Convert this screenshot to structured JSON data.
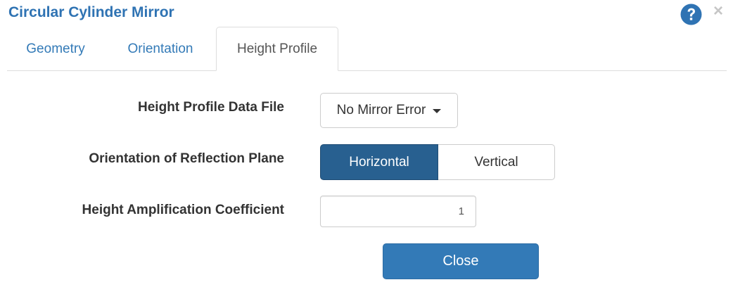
{
  "dialog": {
    "title": "Circular Cylinder Mirror",
    "close_glyph": "×",
    "help_icon": "question-circle-icon"
  },
  "tabs": [
    {
      "label": "Geometry",
      "active": false
    },
    {
      "label": "Orientation",
      "active": false
    },
    {
      "label": "Height Profile",
      "active": true
    }
  ],
  "form": {
    "data_file": {
      "label": "Height Profile Data File",
      "selected": "No Mirror Error"
    },
    "reflection_plane": {
      "label": "Orientation of Reflection Plane",
      "options": [
        "Horizontal",
        "Vertical"
      ],
      "selected": "Horizontal"
    },
    "amplification": {
      "label": "Height Amplification Coefficient",
      "value": "1"
    }
  },
  "footer": {
    "close_label": "Close"
  },
  "colors": {
    "accent": "#2f73b3",
    "primary_button": "#337ab7",
    "active_toggle": "#286090"
  }
}
